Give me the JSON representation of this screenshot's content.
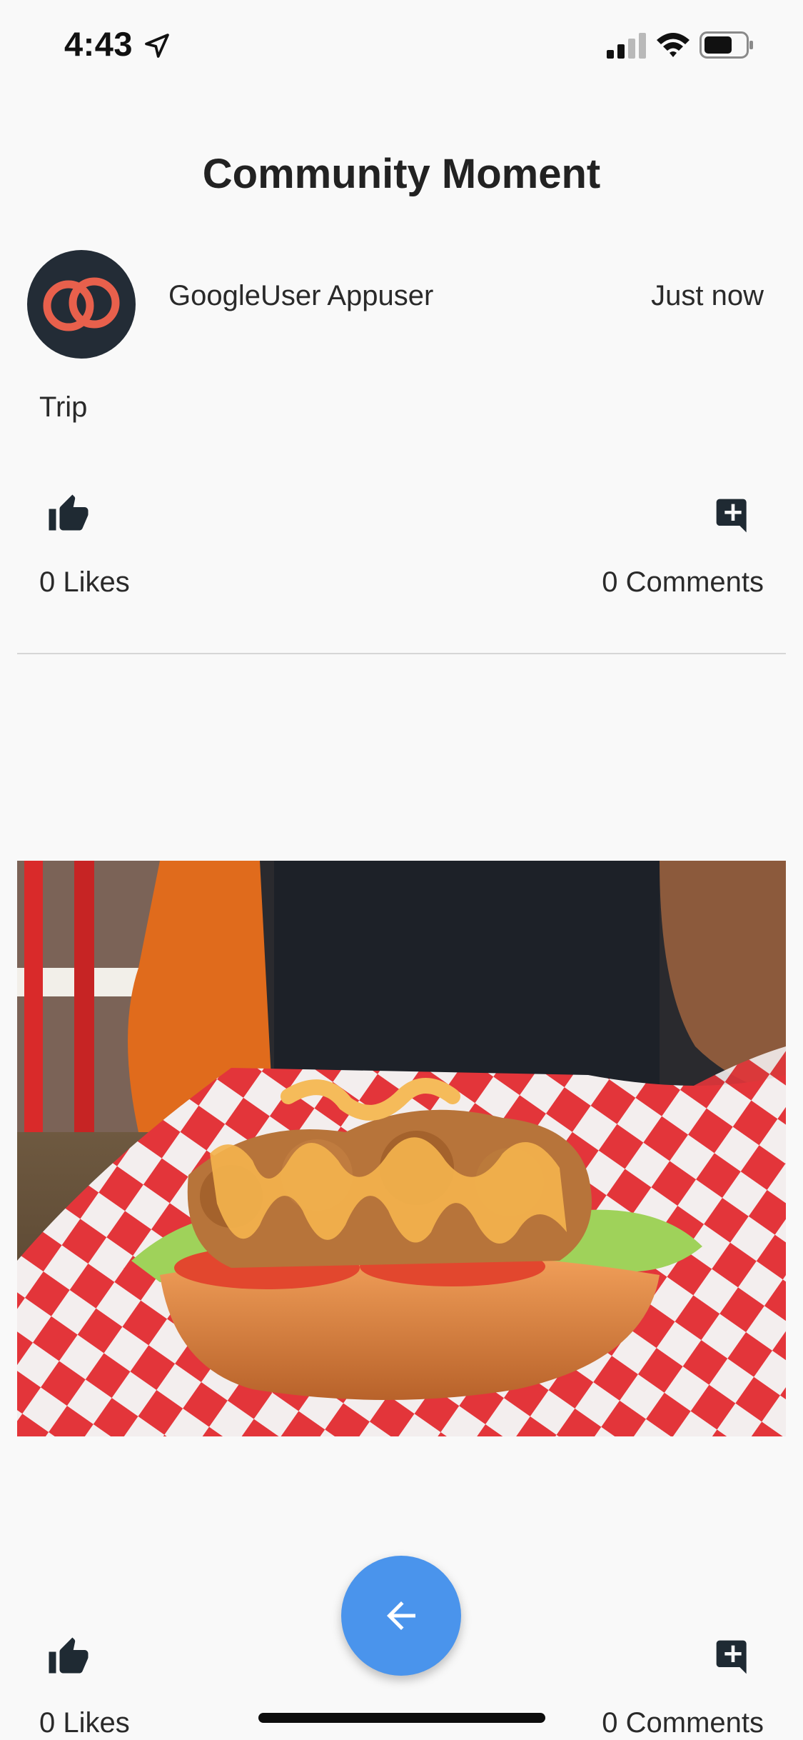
{
  "status_bar": {
    "time": "4:43"
  },
  "header": {
    "title": "Community Moment"
  },
  "post": {
    "author": "GoogleUser Appuser",
    "time": "Just now",
    "text": "Trip",
    "likes_label": "0 Likes",
    "comments_label": "0 Comments"
  },
  "footer": {
    "likes_label": "0 Likes",
    "comments_label": "0 Comments"
  },
  "colors": {
    "fab": "#4a94ec",
    "avatar_bg": "#232c36",
    "avatar_logo": "#e8604c",
    "icon": "#1f2a33"
  },
  "icons": {
    "status_location": "location-arrow-icon",
    "status_signal": "cellular-signal-icon",
    "status_wifi": "wifi-icon",
    "status_battery": "battery-icon",
    "like": "thumbs-up-icon",
    "comment": "add-comment-icon",
    "back": "arrow-left-icon"
  }
}
